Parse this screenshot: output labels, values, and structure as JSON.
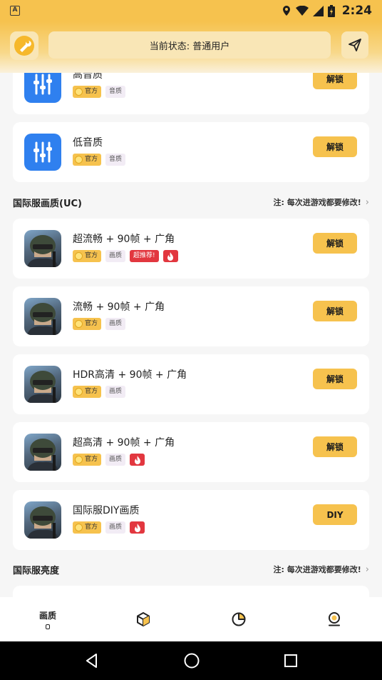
{
  "status_bar": {
    "app_badge": "A",
    "time": "2:24"
  },
  "header": {
    "status_text": "当前状态: 普通用户"
  },
  "cards_top": [
    {
      "title": "高音质",
      "tags": [
        "官方",
        "音质"
      ],
      "button": "解锁"
    },
    {
      "title": "低音质",
      "tags": [
        "官方",
        "音质"
      ],
      "button": "解锁"
    }
  ],
  "section_uc": {
    "title": "国际服画质(UC)",
    "note": "注: 每次进游戏都要修改!"
  },
  "cards_uc": [
    {
      "title": "超流畅 + 90帧 + 广角",
      "official": "官方",
      "category": "画质",
      "hot": "超推荐!",
      "fire": true,
      "button": "解锁"
    },
    {
      "title": "流畅 + 90帧 + 广角",
      "official": "官方",
      "category": "画质",
      "button": "解锁"
    },
    {
      "title": "HDR高清 + 90帧 + 广角",
      "official": "官方",
      "category": "画质",
      "button": "解锁"
    },
    {
      "title": "超高清 + 90帧 + 广角",
      "official": "官方",
      "category": "画质",
      "fire": true,
      "button": "解锁"
    },
    {
      "title": "国际服DIY画质",
      "official": "官方",
      "category": "画质",
      "fire": true,
      "button": "DIY"
    }
  ],
  "section_brightness": {
    "title": "国际服亮度",
    "note": "注: 每次进游戏都要修改!"
  },
  "bottom_nav": [
    {
      "label": "画质",
      "icon": "quality-icon",
      "active": true
    },
    {
      "label": "",
      "icon": "cube-icon"
    },
    {
      "label": "",
      "icon": "pie-chart-icon"
    },
    {
      "label": "",
      "icon": "profile-icon"
    }
  ],
  "colors": {
    "accent": "#f6c24e",
    "hot": "#e2373f",
    "icon_blue": "#2f80ef"
  }
}
